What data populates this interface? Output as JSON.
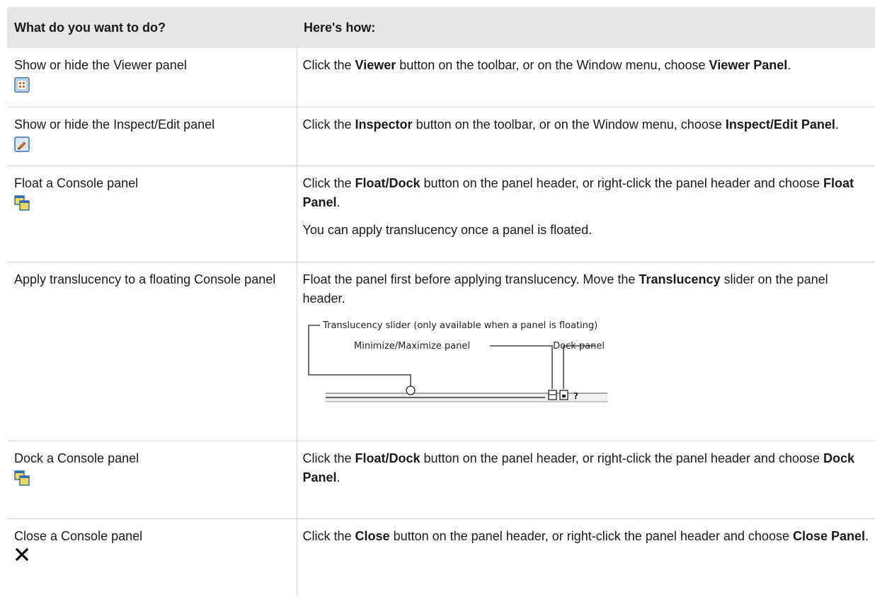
{
  "table": {
    "headers": [
      "What do you want to do?",
      "Here's how:"
    ],
    "rows": [
      {
        "task": "Show or hide the Viewer panel",
        "icon": "viewer-icon",
        "how": [
          "Click the ",
          "Viewer",
          " button on the toolbar, or on the Window menu, choose ",
          "Viewer Panel",
          "."
        ]
      },
      {
        "task": "Show or hide the Inspect/Edit panel",
        "icon": "inspector-icon",
        "how": [
          "Click the ",
          "Inspector",
          " button on the toolbar, or on the Window menu, choose ",
          "Inspect/Edit Panel",
          "."
        ]
      },
      {
        "task": "Float a Console panel",
        "icon": "float-dock-icon",
        "how": [
          "Click the ",
          "Float/Dock",
          " button on the panel header, or right-click the panel header and choose ",
          "Float Panel",
          "."
        ],
        "note": "You can apply translucency once a panel is floated."
      },
      {
        "task": "Apply translucency to a floating Console panel",
        "how": [
          "Float the panel first before applying translucency. Move the ",
          "Translucency",
          " slider on the panel header."
        ],
        "diagram": {
          "slider_label": "Translucency slider (only available when a panel is floating)",
          "minimize_label": "Minimize/Maximize panel",
          "dock_label": "Dock panel",
          "help_glyph": "?"
        }
      },
      {
        "task": "Dock a Console panel",
        "icon": "float-dock-icon",
        "how": [
          "Click the ",
          "Float/Dock",
          " button on the panel header, or right-click the panel header and choose ",
          "Dock Panel",
          "."
        ]
      },
      {
        "task": "Close a Console panel",
        "icon": "close-icon",
        "how": [
          "Click the ",
          "Close",
          " button on the panel header, or right-click the panel header and choose ",
          "Close Panel",
          "."
        ]
      }
    ]
  },
  "colors": {
    "header_bg": "#e6e6e6",
    "row_border": "#d9d9d9",
    "icon_blue": "#2f6fb0",
    "icon_yellow": "#f2d75c"
  }
}
